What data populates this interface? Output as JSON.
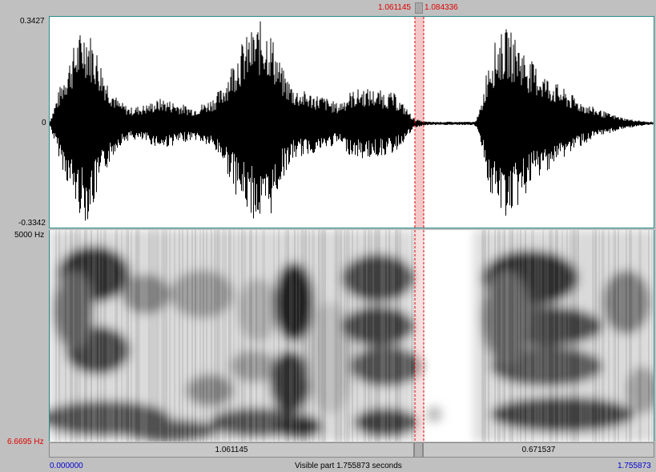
{
  "cursor": {
    "start_label": "1.061145",
    "end_label": "1.084336"
  },
  "waveform": {
    "amp_max": "0.3427",
    "amp_zero": "0",
    "amp_min": "-0.3342"
  },
  "spectrogram": {
    "freq_max": "5000 Hz",
    "freq_min": "6.6695 Hz"
  },
  "duration_bar": {
    "left_segment": "1.061145",
    "right_segment": "0.671537"
  },
  "status_bar": {
    "start_time": "0.000000",
    "visible_part": "Visible part 1.755873 seconds",
    "end_time": "1.755873"
  },
  "colors": {
    "selection_line": "#e00000",
    "selection_fill": "#f4c8c8",
    "start_time_color": "#0000d0",
    "panel_border": "#2a8a8a"
  }
}
